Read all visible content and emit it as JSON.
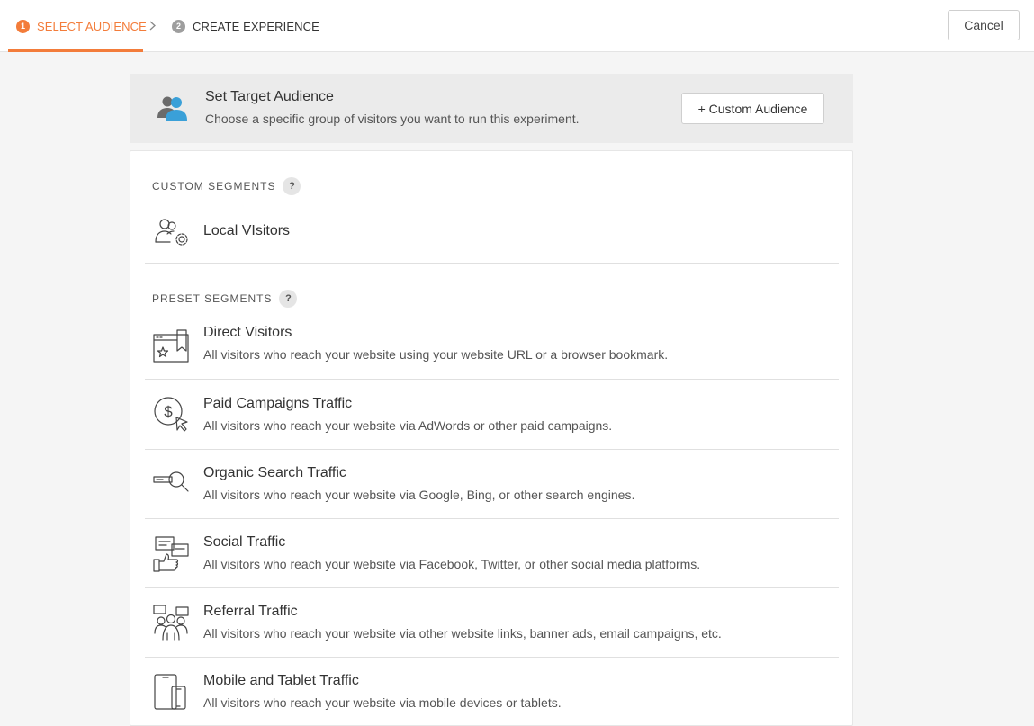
{
  "steps": [
    {
      "number": "1",
      "label": "SELECT AUDIENCE"
    },
    {
      "number": "2",
      "label": "CREATE EXPERIENCE"
    }
  ],
  "cancel_label": "Cancel",
  "audience_header": {
    "title": "Set Target Audience",
    "subtitle": "Choose a specific group of visitors you want to run this experiment.",
    "custom_button": "+ Custom Audience"
  },
  "custom_segments": {
    "label": "CUSTOM SEGMENTS",
    "help": "?",
    "items": [
      {
        "title": "Local VIsitors",
        "icon": "users-gear-icon"
      }
    ]
  },
  "preset_segments": {
    "label": "PRESET SEGMENTS",
    "help": "?",
    "items": [
      {
        "title": "Direct Visitors",
        "description": "All visitors who reach your website using your website URL or a browser bookmark.",
        "icon": "browser-bookmark-icon"
      },
      {
        "title": "Paid Campaigns Traffic",
        "description": "All visitors who reach your website via AdWords or other paid campaigns.",
        "icon": "dollar-cursor-icon"
      },
      {
        "title": "Organic Search Traffic",
        "description": "All visitors who reach your website via Google, Bing, or other search engines.",
        "icon": "search-bar-icon"
      },
      {
        "title": "Social Traffic",
        "description": "All visitors who reach your website via Facebook, Twitter, or other social media platforms.",
        "icon": "social-thumbs-up-icon"
      },
      {
        "title": "Referral Traffic",
        "description": "All visitors who reach your website via other website links, banner ads, email campaigns, etc.",
        "icon": "referral-people-icon"
      },
      {
        "title": "Mobile and Tablet Traffic",
        "description": "All visitors who reach your website via mobile devices or tablets.",
        "icon": "mobile-tablet-icon"
      }
    ]
  },
  "colors": {
    "accent": "#f37c3a",
    "audience_icon": "#3aa0d8"
  }
}
